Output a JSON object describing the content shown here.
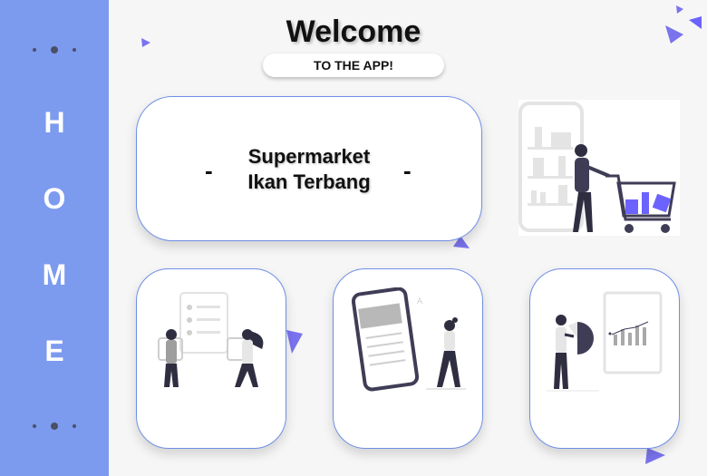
{
  "sidebar": {
    "letters": [
      "H",
      "O",
      "M",
      "E"
    ]
  },
  "header": {
    "title": "Welcome",
    "subtitle": "TO THE APP!"
  },
  "main_card": {
    "line1": "Supermarket",
    "line2": "Ikan Terbang",
    "dash": "-"
  },
  "colors": {
    "sidebar": "#7c9bef",
    "accent": "#6c63ff",
    "card_border": "#6f8fe6",
    "background": "#f6f6f6"
  },
  "cards": [
    {
      "illustration": "checklist-people-icon"
    },
    {
      "illustration": "mobile-app-icon"
    },
    {
      "illustration": "presentation-chart-icon"
    }
  ],
  "side_illustration": "shopping-cart-icon"
}
